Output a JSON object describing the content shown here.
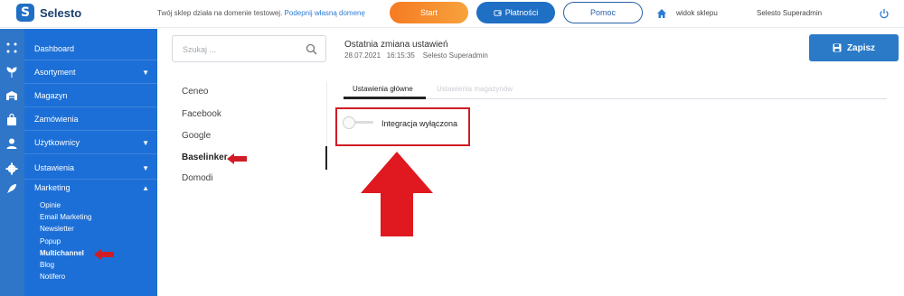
{
  "topbar": {
    "logo_text": "Selesto",
    "domain_note": "Twój sklep działa na domenie testowej.",
    "domain_link": "Podepnij własną domenę",
    "start_label": "Start",
    "payments_label": "Płatności",
    "help_label": "Pomoc",
    "store_view_label": "widok sklepu",
    "user_name": "Selesto Superadmin"
  },
  "sidebar": {
    "items": [
      {
        "label": "Dashboard",
        "icon": "dashboard-grid-icon"
      },
      {
        "label": "Asortyment",
        "icon": "plant-icon",
        "caret": "▼"
      },
      {
        "label": "Magazyn",
        "icon": "warehouse-icon"
      },
      {
        "label": "Zamówienia",
        "icon": "bag-icon"
      },
      {
        "label": "Użytkownicy",
        "icon": "user-icon",
        "caret": "▼"
      },
      {
        "label": "Ustawienia",
        "icon": "gear-icon",
        "caret": "▼"
      },
      {
        "label": "Marketing",
        "icon": "rocket-icon",
        "caret": "▲"
      }
    ],
    "marketing_sub": [
      "Opinie",
      "Email Marketing",
      "Newsletter",
      "Popup",
      "Multichannel",
      "Blog",
      "Notifero"
    ],
    "active_sub": "Multichannel"
  },
  "search": {
    "placeholder": "Szukaj ..."
  },
  "integrations": {
    "items": [
      "Ceneo",
      "Facebook",
      "Google",
      "Baselinker",
      "Domodi"
    ],
    "active": "Baselinker"
  },
  "header": {
    "last_change_title": "Ostatnia zmiana ustawień",
    "last_change_date": "28.07.2021",
    "last_change_time": "16:15:35",
    "last_change_user": "Selesto Superadmin",
    "save_label": "Zapisz"
  },
  "tabs": {
    "main": "Ustawienia główne",
    "store": "Ustawienia magazynów"
  },
  "integration_toggle": {
    "label": "Integracja wyłączona",
    "enabled": false
  },
  "colors": {
    "sidebar": "#1c6fd6",
    "rail": "#2f76c9",
    "accent_orange": "#f57b22",
    "accent_blue": "#1f6fc4",
    "annotation_red": "#d01c24"
  }
}
